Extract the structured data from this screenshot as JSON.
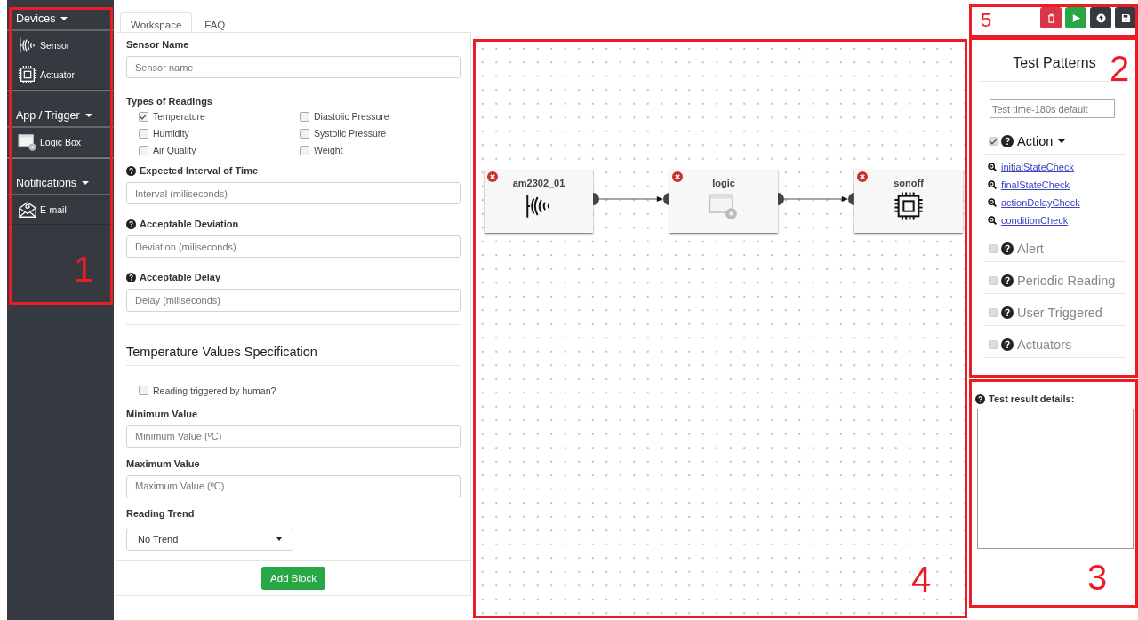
{
  "sidebar": {
    "sections": [
      {
        "title": "Devices",
        "items": [
          {
            "label": "Sensor",
            "kind": "sensor"
          },
          {
            "label": "Actuator",
            "kind": "chip"
          }
        ]
      },
      {
        "title": "App / Trigger",
        "items": [
          {
            "label": "Logic Box",
            "kind": "logic"
          }
        ]
      },
      {
        "title": "Notifications",
        "items": [
          {
            "label": "E-mail",
            "kind": "email"
          }
        ]
      }
    ]
  },
  "tabs": [
    {
      "label": "Workspace",
      "selected": true
    },
    {
      "label": "FAQ",
      "selected": false
    }
  ],
  "form": {
    "sensor_name": {
      "label": "Sensor Name",
      "placeholder": "Sensor name"
    },
    "readings": {
      "title": "Types of Readings",
      "options": [
        {
          "label": "Temperature",
          "checked": true
        },
        {
          "label": "Diastolic Pressure",
          "checked": false
        },
        {
          "label": "Humidity",
          "checked": false
        },
        {
          "label": "Systolic Pressure",
          "checked": false
        },
        {
          "label": "Air Quality",
          "checked": false
        },
        {
          "label": "Weight",
          "checked": false
        }
      ]
    },
    "timing_fields": [
      {
        "label": "Expected Interval of Time",
        "placeholder": "Interval (miliseconds)"
      },
      {
        "label": "Acceptable Deviation",
        "placeholder": "Deviation (miliseconds)"
      },
      {
        "label": "Acceptable Delay",
        "placeholder": "Delay (miliseconds)"
      }
    ],
    "section_title": "Temperature Values Specification",
    "human_trigger": {
      "label": "Reading triggered by human?",
      "checked": false
    },
    "value_fields": [
      {
        "label": "Minimum Value",
        "placeholder": "Minimum Value (ºC)"
      },
      {
        "label": "Maximum Value",
        "placeholder": "Maximum Value (ºC)"
      }
    ],
    "trend": {
      "label": "Reading Trend",
      "value": "No Trend"
    },
    "add_button": "Add Block"
  },
  "canvas": {
    "nodes": [
      {
        "title": "am2302_01",
        "kind": "sensor"
      },
      {
        "title": "logic",
        "kind": "logic"
      },
      {
        "title": "sonoff",
        "kind": "chip"
      }
    ]
  },
  "toolbar": [
    {
      "kind": "delete"
    },
    {
      "kind": "run"
    },
    {
      "kind": "upload"
    },
    {
      "kind": "save"
    }
  ],
  "test_patterns": {
    "title": "Test Patterns",
    "time_placeholder": "Test time-180s default",
    "patterns": [
      {
        "label": "Action",
        "checked": true,
        "expanded": true,
        "links": [
          "initialStateCheck",
          "finalStateCheck",
          "actionDelayCheck",
          "conditionCheck"
        ]
      },
      {
        "label": "Alert",
        "checked": false,
        "expanded": false
      },
      {
        "label": "Periodic Reading",
        "checked": false,
        "expanded": false
      },
      {
        "label": "User Triggered",
        "checked": false,
        "expanded": false
      },
      {
        "label": "Actuators",
        "checked": false,
        "expanded": false
      }
    ]
  },
  "results": {
    "label": "Test result details:"
  },
  "annotations": [
    {
      "label": "1"
    },
    {
      "label": "2"
    },
    {
      "label": "3"
    },
    {
      "label": "4"
    },
    {
      "label": "5"
    }
  ]
}
